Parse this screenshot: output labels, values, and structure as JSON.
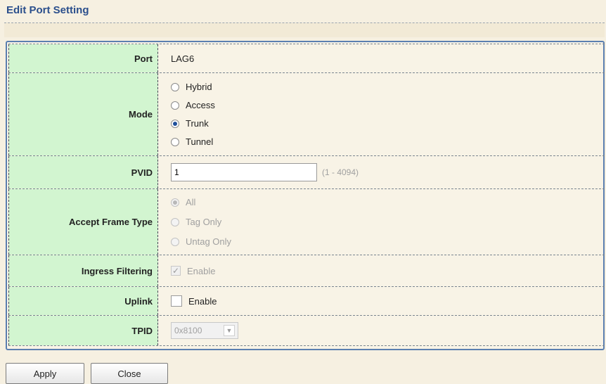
{
  "title": "Edit Port Setting",
  "form": {
    "port": {
      "label": "Port",
      "value": "LAG6"
    },
    "mode": {
      "label": "Mode",
      "options": [
        "Hybrid",
        "Access",
        "Trunk",
        "Tunnel"
      ],
      "selected": "Trunk"
    },
    "pvid": {
      "label": "PVID",
      "value": "1",
      "range": "(1 - 4094)"
    },
    "accept_frame_type": {
      "label": "Accept Frame Type",
      "options": [
        "All",
        "Tag Only",
        "Untag Only"
      ],
      "selected": "All",
      "disabled": true
    },
    "ingress_filtering": {
      "label": "Ingress Filtering",
      "checkbox_label": "Enable",
      "checked": true,
      "disabled": true
    },
    "uplink": {
      "label": "Uplink",
      "checkbox_label": "Enable",
      "checked": false
    },
    "tpid": {
      "label": "TPID",
      "value": "0x8100",
      "disabled": true
    }
  },
  "buttons": {
    "apply": "Apply",
    "close": "Close"
  },
  "colors": {
    "label_bg": "#d2f5d0",
    "title": "#2b4f8c",
    "panel_border": "#5b7fb0"
  }
}
